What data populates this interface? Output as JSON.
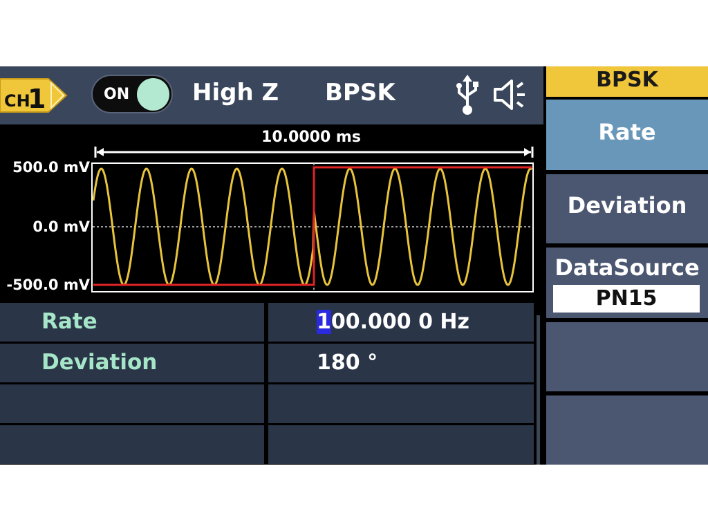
{
  "status_bar": {
    "channel": "CH1",
    "channel_prefix": "CH",
    "channel_number": "1",
    "output_toggle": "ON",
    "load": "High Z",
    "modulation": "BPSK",
    "icons": [
      "usb-icon",
      "speaker-icon"
    ]
  },
  "waveform": {
    "time_span": "10.0000 ms",
    "y_labels": {
      "top": "500.0 mV",
      "mid": "0.0 mV",
      "bottom": "-500.0 mV"
    },
    "carrier_color": "#e8c43c",
    "modulating_color": "#e02424"
  },
  "params": {
    "rows": [
      {
        "name": "Rate",
        "value_cursor": "1",
        "value_rest": "00.000 0 Hz"
      },
      {
        "name": "Deviation",
        "value": "180 °"
      }
    ]
  },
  "menu": {
    "title": "BPSK",
    "items": [
      {
        "label": "Rate",
        "selected": true
      },
      {
        "label": "Deviation"
      },
      {
        "label": "DataSource",
        "value": "PN15"
      }
    ]
  },
  "colors": {
    "accent": "#f0c63a",
    "panel": "#3a465c",
    "menu_selected": "#6997b9",
    "param_name": "#a6e6c8"
  }
}
